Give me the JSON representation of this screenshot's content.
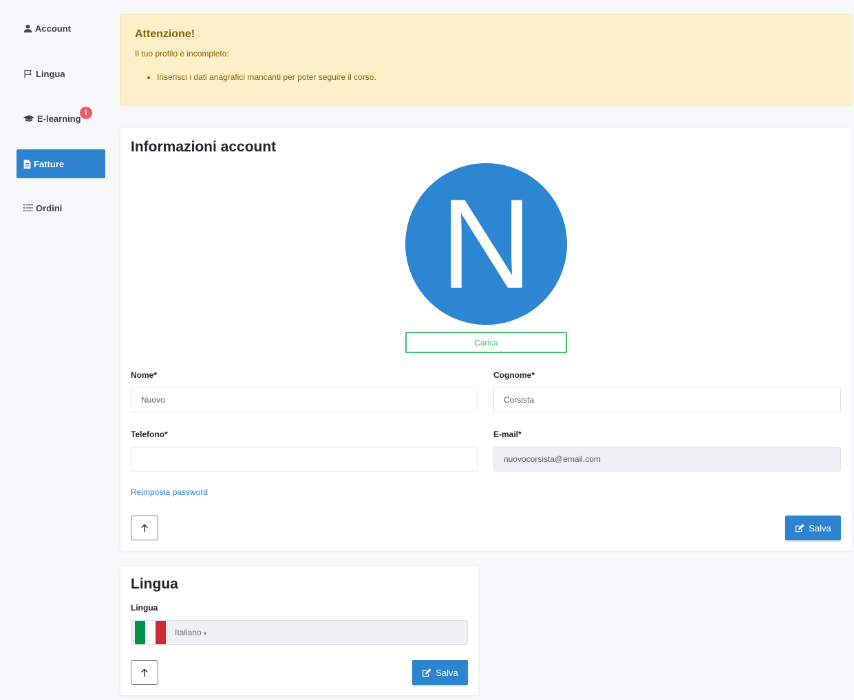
{
  "sidebar": {
    "items": [
      {
        "label": "Account",
        "icon": "user-icon"
      },
      {
        "label": "Lingua",
        "icon": "flag-icon"
      },
      {
        "label": "E-learning",
        "icon": "graduation-cap-icon",
        "badge": "!"
      },
      {
        "label": "Fatture",
        "icon": "file-invoice-icon",
        "active": true
      },
      {
        "label": "Ordini",
        "icon": "list-icon"
      }
    ]
  },
  "alert": {
    "title": "Attenzione!",
    "text": "Il tuo profilo è incompleto:",
    "items": [
      "Inserisci i dati anagrafici mancanti per poter seguire il corso."
    ]
  },
  "account": {
    "title": "Informazioni account",
    "avatar_letter": "N",
    "upload_label": "Carica",
    "fields": {
      "nome": {
        "label": "Nome",
        "value": "Nuovo"
      },
      "cognome": {
        "label": "Cognome",
        "value": "Corsista"
      },
      "telefono": {
        "label": "Telefono",
        "value": ""
      },
      "email": {
        "label": "E-mail",
        "value": "nuovocorsista@email.com"
      }
    },
    "required_mark": "*",
    "reset_password": "Reimposta password",
    "save_label": "Salva"
  },
  "lingua": {
    "title": "Lingua",
    "field_label": "Lingua",
    "selected": "Italiano",
    "caret": "▾",
    "save_label": "Salva"
  },
  "colors": {
    "primary": "#2d83cf",
    "success": "#3ec26a",
    "warning_bg": "#fdf0c8",
    "warning_text": "#856404",
    "badge": "#f05a6a",
    "flag_green": "#009246",
    "flag_white": "#ffffff",
    "flag_red": "#ce2b37"
  }
}
